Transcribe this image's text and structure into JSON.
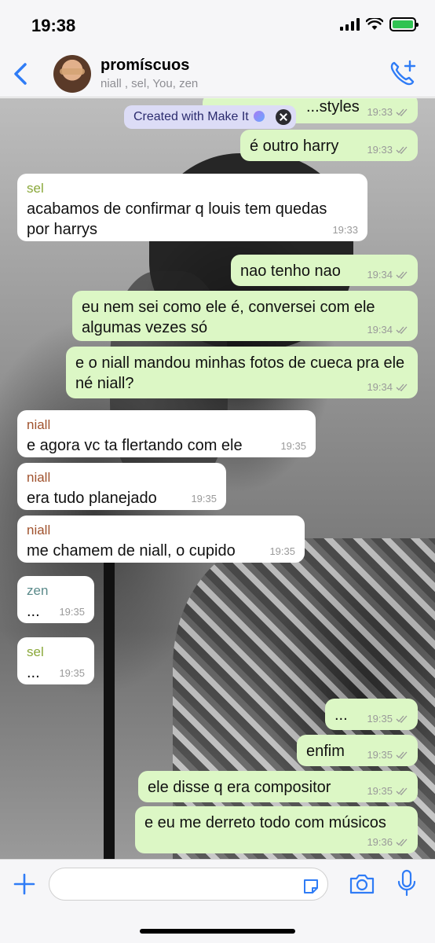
{
  "status_bar": {
    "time": "19:38"
  },
  "header": {
    "title": "promíscuos",
    "subtitle": "niall , sel, You, zen"
  },
  "badge": {
    "label": "Created with Make It"
  },
  "messages": [
    {
      "dir": "out",
      "text": "...styles",
      "time": "19:33"
    },
    {
      "dir": "out",
      "text": "é outro harry",
      "time": "19:33"
    },
    {
      "dir": "in",
      "sender": "sel",
      "sender_color": "#8aa83a",
      "text": "acabamos de confirmar q louis tem quedas por harrys",
      "time": "19:33"
    },
    {
      "dir": "out",
      "text": "nao tenho nao",
      "time": "19:34"
    },
    {
      "dir": "out",
      "text": "eu nem sei como ele é, conversei com ele algumas vezes só",
      "time": "19:34"
    },
    {
      "dir": "out",
      "text": "e o niall mandou minhas fotos de cueca pra ele né niall?",
      "time": "19:34"
    },
    {
      "dir": "in",
      "sender": "niall",
      "sender_color": "#a0522d",
      "text": "e agora vc ta flertando com ele",
      "time": "19:35"
    },
    {
      "dir": "in",
      "sender": "niall",
      "sender_color": "#a0522d",
      "text": "era tudo planejado",
      "time": "19:35"
    },
    {
      "dir": "in",
      "sender": "niall",
      "sender_color": "#a0522d",
      "text": "me chamem de niall, o cupido",
      "time": "19:35"
    },
    {
      "dir": "in",
      "sender": "zen",
      "sender_color": "#5a8a8a",
      "text": "...",
      "time": "19:35"
    },
    {
      "dir": "in",
      "sender": "sel",
      "sender_color": "#8aa83a",
      "text": "...",
      "time": "19:35"
    },
    {
      "dir": "out",
      "text": "...",
      "time": "19:35"
    },
    {
      "dir": "out",
      "text": "enfim",
      "time": "19:35"
    },
    {
      "dir": "out",
      "text": "ele disse q era compositor",
      "time": "19:35"
    },
    {
      "dir": "out",
      "text": "e eu me derreto todo com músicos",
      "time": "19:36"
    }
  ],
  "input": {
    "placeholder": ""
  },
  "colors": {
    "outgoing_bubble": "#dcf7c5",
    "incoming_bubble": "#ffffff",
    "accent": "#2f7cf6"
  }
}
